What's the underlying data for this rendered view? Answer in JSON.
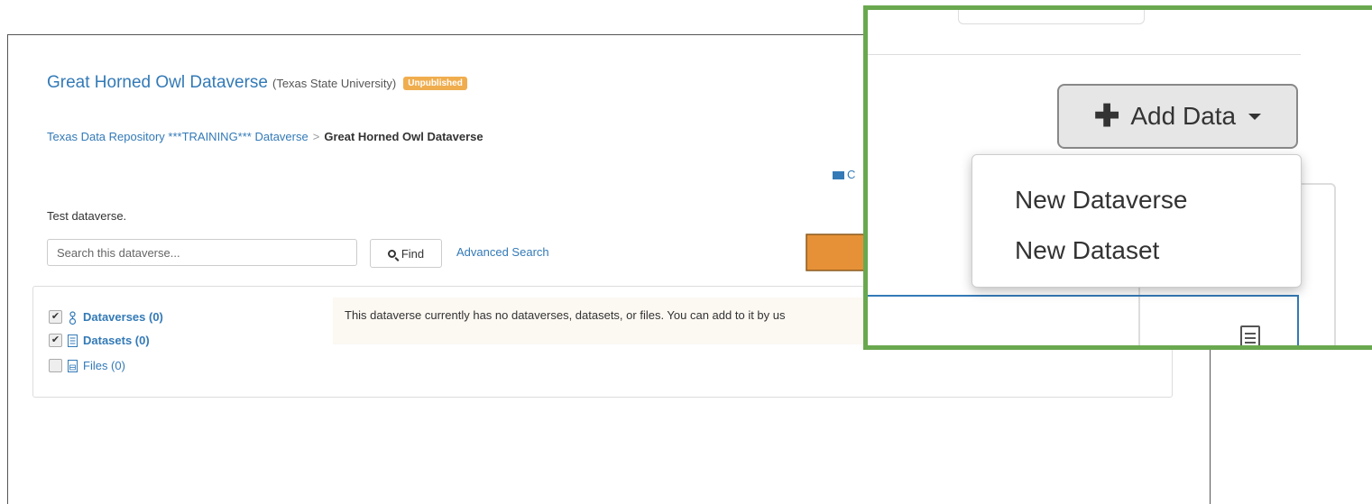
{
  "header": {
    "title": "Great Horned Owl Dataverse",
    "affiliation": "(Texas State University)",
    "status_badge": "Unpublished"
  },
  "breadcrumb": {
    "parent": "Texas Data Repository ***TRAINING*** Dataverse",
    "separator": ">",
    "current": "Great Horned Owl Dataverse"
  },
  "contact": {
    "label_visible": "C",
    "icon": "envelope-icon"
  },
  "description": "Test dataverse.",
  "search": {
    "placeholder": "Search this dataverse...",
    "find_label": "Find",
    "advanced_label": "Advanced Search"
  },
  "facets": [
    {
      "label": "Dataverses (0)",
      "checked": true,
      "icon": "dataverse-icon"
    },
    {
      "label": "Datasets (0)",
      "checked": true,
      "icon": "dataset-icon"
    },
    {
      "label": "Files (0)",
      "checked": false,
      "icon": "file-icon"
    }
  ],
  "notice": "This dataverse currently has no dataverses, datasets, or files. You can add to it by us",
  "inset": {
    "add_data_label": "Add Data",
    "menu": [
      "New Dataverse",
      "New Dataset"
    ]
  },
  "colors": {
    "link": "#337ab7",
    "badge": "#f0ad4e",
    "highlight_border": "#6aa84f",
    "arrow": "#e69138"
  }
}
